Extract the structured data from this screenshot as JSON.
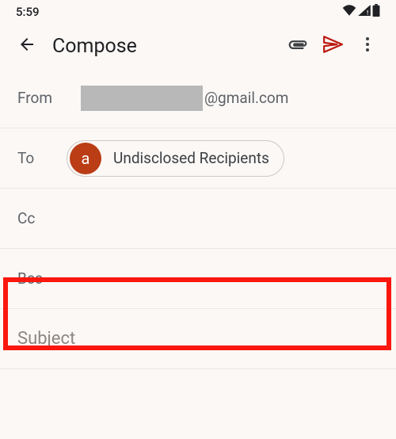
{
  "status": {
    "time": "5:59"
  },
  "appbar": {
    "title": "Compose"
  },
  "from": {
    "label": "From",
    "domain": "@gmail.com"
  },
  "to": {
    "label": "To",
    "chip": {
      "initial": "a",
      "name": "Undisclosed Recipients"
    }
  },
  "cc": {
    "label": "Cc"
  },
  "bcc": {
    "label": "Bcc"
  },
  "subject": {
    "placeholder": "Subject"
  },
  "highlight": {
    "target": "bcc-row"
  }
}
